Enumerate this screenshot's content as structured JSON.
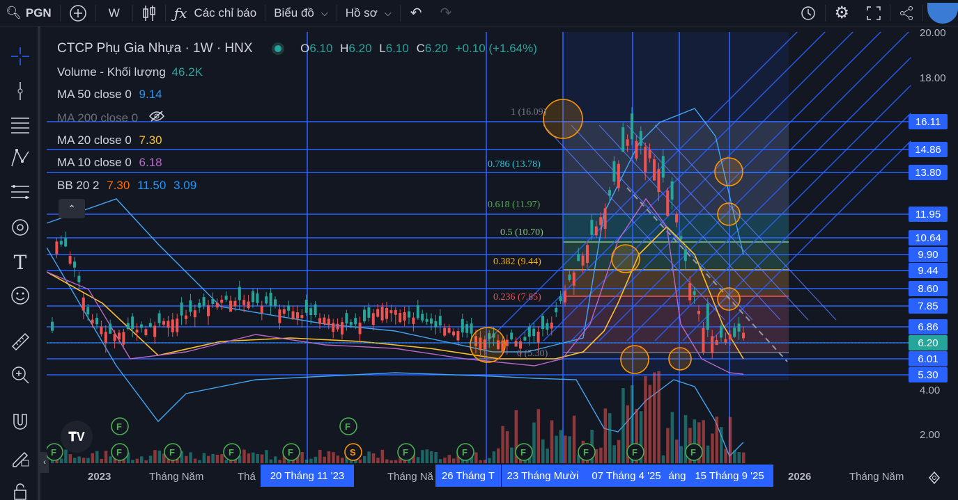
{
  "toolbar": {
    "symbol": "PGN",
    "add_icon": "plus-circle-icon",
    "interval": "W",
    "chart_type_icon": "candles-icon",
    "indicators_label": "Các chỉ báo",
    "chart_label": "Biểu đồ",
    "profile_label": "Hồ sơ",
    "undo_icon": "undo-icon",
    "redo_icon": "redo-icon"
  },
  "legend": {
    "title": "CTCP Phụ Gia Nhựa · 1W · HNX",
    "ohlc": {
      "o_label": "O",
      "o": "6.10",
      "h_label": "H",
      "h": "6.20",
      "l_label": "L",
      "l": "6.10",
      "c_label": "C",
      "c": "6.20",
      "change": "+0.10 (+1.64%)"
    },
    "volume_label": "Volume - Khối lượng",
    "volume_value": "46.2K",
    "ma50_label": "MA 50 close 0",
    "ma50_value": "9.14",
    "ma200_label": "MA 200 close 0",
    "ma20_label": "MA 20 close 0",
    "ma20_value": "7.30",
    "ma10_label": "MA 10 close 0",
    "ma10_value": "6.18",
    "bb_label": "BB 20 2",
    "bb_basis": "7.30",
    "bb_upper": "11.50",
    "bb_lower": "3.09"
  },
  "price_axis": {
    "ticks": [
      "20.00",
      "18.00",
      "4.00",
      "2.00"
    ],
    "tags": [
      "16.11",
      "14.86",
      "13.80",
      "11.95",
      "10.64",
      "9.90",
      "9.44",
      "8.60",
      "7.85",
      "6.86",
      "6.20",
      "6.01",
      "5.30"
    ]
  },
  "fib_labels": [
    "1 (16.09)",
    "0.786 (13.78)",
    "0.618 (11.97)",
    "0.5 (10.70)",
    "0.382 (9.44)",
    "0.236 (7.85)",
    "0 (5.30)"
  ],
  "time_axis": {
    "labels": [
      "2023",
      "Tháng Năm",
      "Thá",
      "Tháng Nă",
      "2026",
      "Tháng Năm"
    ],
    "tags": [
      "20 Tháng 11 '23",
      "26 Tháng T",
      "23 Tháng Mười",
      "07 Tháng 4 '25",
      "áng",
      "15 Tháng 9 '25"
    ]
  },
  "colors": {
    "accent": "#2962ff",
    "up": "#26a69a",
    "down": "#ef5350",
    "bg": "#131722"
  }
}
